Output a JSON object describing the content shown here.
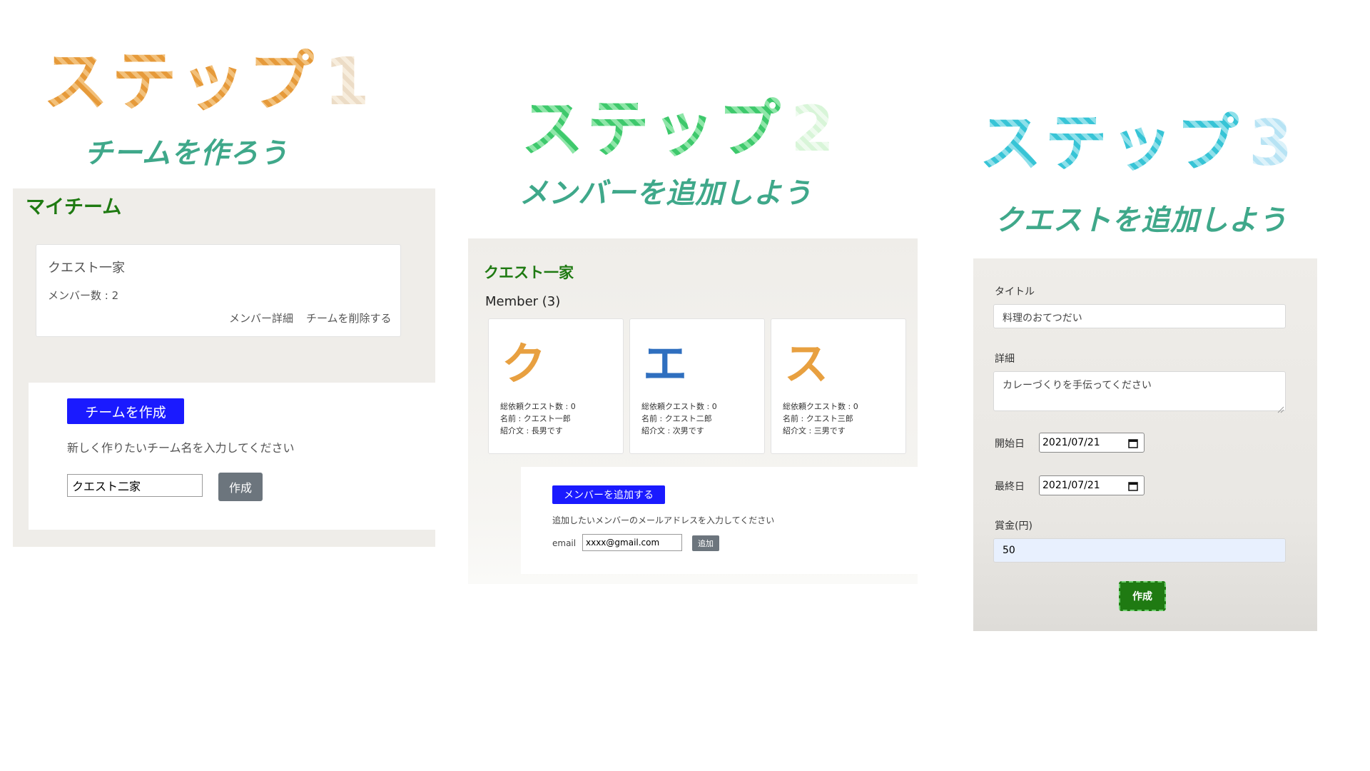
{
  "step1": {
    "title_text": "ステップ",
    "title_num": "1",
    "subtitle": "チームを作ろう",
    "panel_heading": "マイチーム",
    "team_card": {
      "name": "クエスト一家",
      "member_count": "メンバー数 : 2",
      "detail_link": "メンバー詳細",
      "delete_link": "チームを削除する"
    },
    "create": {
      "button": "チームを作成",
      "instruction": "新しく作りたいチーム名を入力してください",
      "input_value": "クエスト二家",
      "submit": "作成"
    }
  },
  "step2": {
    "title_text": "ステップ",
    "title_num": "2",
    "subtitle": "メンバーを追加しよう",
    "team_name": "クエスト一家",
    "member_heading": "Member (3)",
    "members": [
      {
        "glyph": "ク",
        "quests": "総依頼クエスト数 : 0",
        "name": "名前 : クエスト一郎",
        "intro": "紹介文 : 長男です",
        "color": "#e8a040"
      },
      {
        "glyph": "エ",
        "quests": "総依頼クエスト数 : 0",
        "name": "名前 : クエスト二郎",
        "intro": "紹介文 : 次男です",
        "color": "#2f6fbf"
      },
      {
        "glyph": "ス",
        "quests": "総依頼クエスト数 : 0",
        "name": "名前 : クエスト三郎",
        "intro": "紹介文 : 三男です",
        "color": "#e8a040"
      }
    ],
    "add": {
      "button": "メンバーを追加する",
      "instruction": "追加したいメンバーのメールアドレスを入力してください",
      "email_label": "email",
      "email_value": "xxxx@gmail.com",
      "submit": "追加"
    }
  },
  "step3": {
    "title_text": "ステップ",
    "title_num": "3",
    "subtitle": "クエストを追加しよう",
    "title_label": "タイトル",
    "title_value": "料理のおてつだい",
    "detail_label": "詳細",
    "detail_value": "カレーづくりを手伝ってください",
    "start_label": "開始日",
    "start_value": "2021/07/21",
    "end_label": "最終日",
    "end_value": "2021/07/21",
    "reward_label": "賞金(円)",
    "reward_value": "50",
    "submit": "作成"
  },
  "colors": {
    "accent_green": "#1f7a12",
    "subtitle_teal": "#3fa88a",
    "button_blue": "#1a1aff",
    "button_gray": "#6c757d"
  },
  "icons": [
    "calendar-icon",
    "resize-handle-icon"
  ]
}
